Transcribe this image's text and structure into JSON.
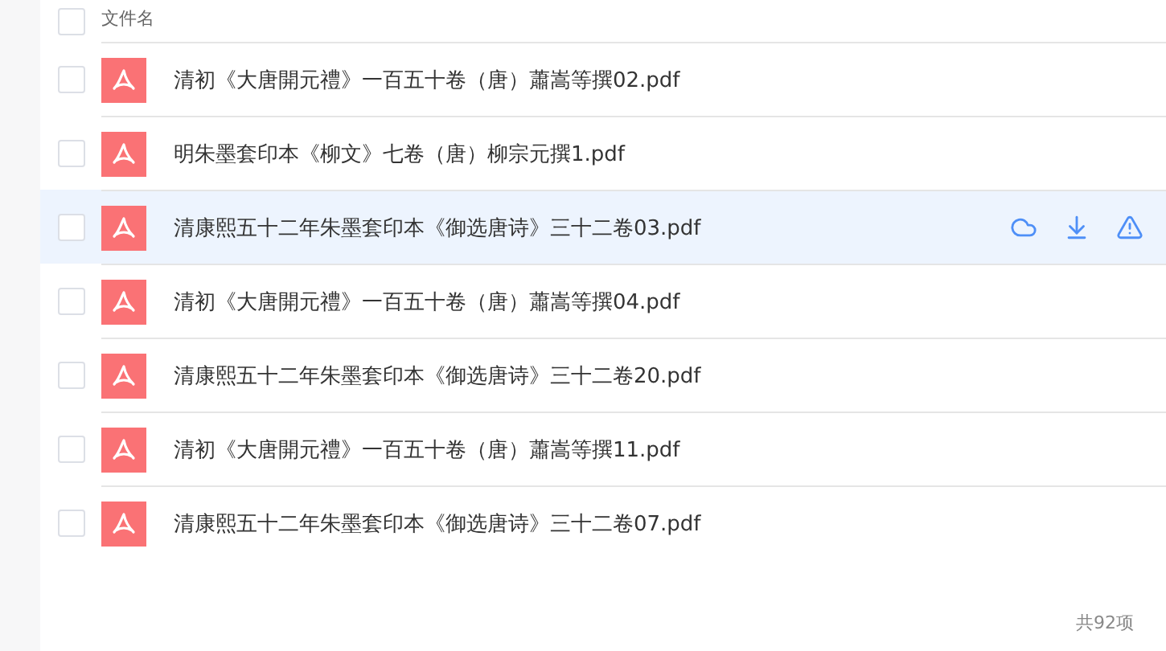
{
  "header": {
    "checked": false,
    "label": "文件名"
  },
  "rows": [
    {
      "name": "清初《大唐開元禮》一百五十卷（唐）蕭嵩等撰02.pdf",
      "checked": false,
      "selected": false
    },
    {
      "name": "明朱墨套印本《柳文》七卷（唐）柳宗元撰1.pdf",
      "checked": false,
      "selected": false
    },
    {
      "name": "清康熙五十二年朱墨套印本《御选唐诗》三十二卷03.pdf",
      "checked": false,
      "selected": true
    },
    {
      "name": "清初《大唐開元禮》一百五十卷（唐）蕭嵩等撰04.pdf",
      "checked": false,
      "selected": false
    },
    {
      "name": "清康熙五十二年朱墨套印本《御选唐诗》三十二卷20.pdf",
      "checked": false,
      "selected": false
    },
    {
      "name": "清初《大唐開元禮》一百五十卷（唐）蕭嵩等撰11.pdf",
      "checked": false,
      "selected": false
    },
    {
      "name": "清康熙五十二年朱墨套印本《御选唐诗》三十二卷07.pdf",
      "checked": false,
      "selected": false
    }
  ],
  "footer": {
    "total": "共92项"
  }
}
